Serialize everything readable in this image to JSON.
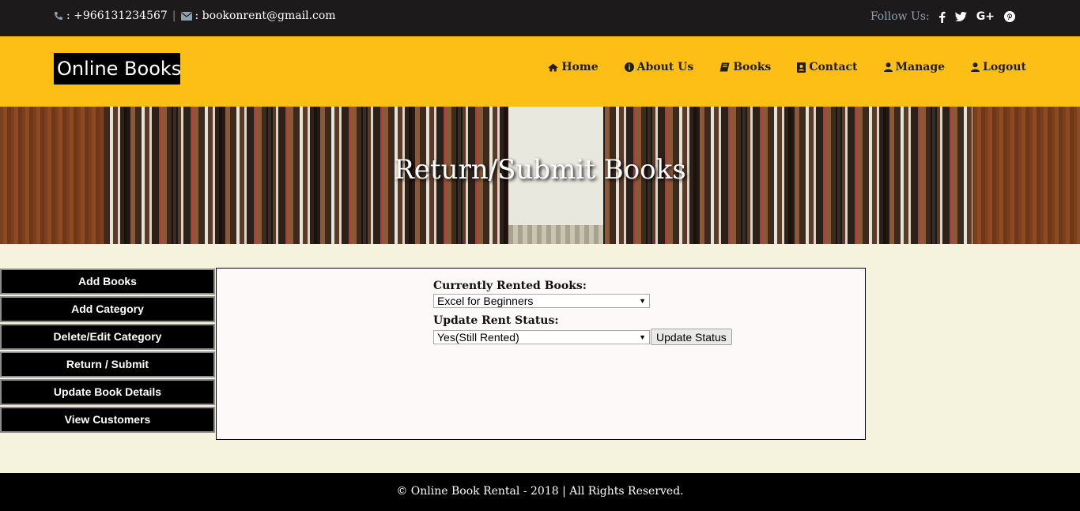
{
  "topbar": {
    "phone": ": +966131234567",
    "separator": "|",
    "email": ": bookonrent@gmail.com",
    "follow_label": "Follow Us:",
    "social": [
      {
        "icon": "facebook-icon",
        "glyph": "f"
      },
      {
        "icon": "twitter-icon",
        "glyph": "🐦"
      },
      {
        "icon": "google-plus-icon",
        "glyph": "G+"
      },
      {
        "icon": "pinterest-icon",
        "glyph": "℗"
      }
    ]
  },
  "header": {
    "logo": "Online Books",
    "nav": [
      {
        "label": "Home",
        "icon": "home-icon"
      },
      {
        "label": "About Us",
        "icon": "info-icon"
      },
      {
        "label": "Books",
        "icon": "book-icon"
      },
      {
        "label": "Contact",
        "icon": "contact-card-icon"
      },
      {
        "label": "Manage",
        "icon": "user-icon"
      },
      {
        "label": "Logout",
        "icon": "user-icon"
      }
    ]
  },
  "banner": {
    "title": "Return/Submit Books"
  },
  "sidebar": {
    "items": [
      {
        "label": "Add Books"
      },
      {
        "label": "Add Category"
      },
      {
        "label": "Delete/Edit Category"
      },
      {
        "label": "Return / Submit"
      },
      {
        "label": "Update Book Details"
      },
      {
        "label": "View Customers"
      }
    ]
  },
  "form": {
    "rented_label": "Currently Rented Books:",
    "rented_selected": "Excel for Beginners",
    "status_label": "Update Rent Status:",
    "status_selected": "Yes(Still Rented)",
    "update_button": "Update Status"
  },
  "footer": {
    "text": "© Online Book Rental - 2018 | All Rights Reserved."
  },
  "colors": {
    "header_bg": "#fdbe16",
    "topbar_bg": "#1c1a1b",
    "page_bg": "#f5f3dd",
    "panel_bg": "#fcf9f8"
  }
}
